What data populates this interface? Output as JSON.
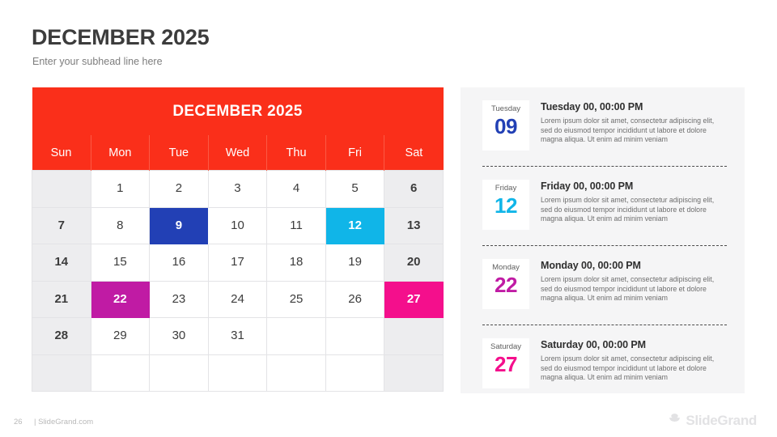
{
  "slide": {
    "title": "DECEMBER 2025",
    "subtitle": "Enter your subhead line here"
  },
  "calendar": {
    "month_title": "DECEMBER 2025",
    "header_color": "#fa2f1a",
    "weekend_bg": "#ededef",
    "day_headers": [
      "Sun",
      "Mon",
      "Tue",
      "Wed",
      "Thu",
      "Fri",
      "Sat"
    ],
    "weeks": [
      [
        {
          "label": "",
          "weekend": true,
          "highlight": null
        },
        {
          "label": "1",
          "weekend": false,
          "highlight": null
        },
        {
          "label": "2",
          "weekend": false,
          "highlight": null
        },
        {
          "label": "3",
          "weekend": false,
          "highlight": null
        },
        {
          "label": "4",
          "weekend": false,
          "highlight": null
        },
        {
          "label": "5",
          "weekend": false,
          "highlight": null
        },
        {
          "label": "6",
          "weekend": true,
          "highlight": null
        }
      ],
      [
        {
          "label": "7",
          "weekend": true,
          "highlight": null
        },
        {
          "label": "8",
          "weekend": false,
          "highlight": null
        },
        {
          "label": "9",
          "weekend": false,
          "highlight": "#2240b5"
        },
        {
          "label": "10",
          "weekend": false,
          "highlight": null
        },
        {
          "label": "11",
          "weekend": false,
          "highlight": null
        },
        {
          "label": "12",
          "weekend": false,
          "highlight": "#10b5e8"
        },
        {
          "label": "13",
          "weekend": true,
          "highlight": null
        }
      ],
      [
        {
          "label": "14",
          "weekend": true,
          "highlight": null
        },
        {
          "label": "15",
          "weekend": false,
          "highlight": null
        },
        {
          "label": "16",
          "weekend": false,
          "highlight": null
        },
        {
          "label": "17",
          "weekend": false,
          "highlight": null
        },
        {
          "label": "18",
          "weekend": false,
          "highlight": null
        },
        {
          "label": "19",
          "weekend": false,
          "highlight": null
        },
        {
          "label": "20",
          "weekend": true,
          "highlight": null
        }
      ],
      [
        {
          "label": "21",
          "weekend": true,
          "highlight": null
        },
        {
          "label": "22",
          "weekend": false,
          "highlight": "#c01ba4"
        },
        {
          "label": "23",
          "weekend": false,
          "highlight": null
        },
        {
          "label": "24",
          "weekend": false,
          "highlight": null
        },
        {
          "label": "25",
          "weekend": false,
          "highlight": null
        },
        {
          "label": "26",
          "weekend": false,
          "highlight": null
        },
        {
          "label": "27",
          "weekend": true,
          "highlight": "#f40f8c"
        }
      ],
      [
        {
          "label": "28",
          "weekend": true,
          "highlight": null
        },
        {
          "label": "29",
          "weekend": false,
          "highlight": null
        },
        {
          "label": "30",
          "weekend": false,
          "highlight": null
        },
        {
          "label": "31",
          "weekend": false,
          "highlight": null
        },
        {
          "label": "",
          "weekend": false,
          "highlight": null
        },
        {
          "label": "",
          "weekend": false,
          "highlight": null
        },
        {
          "label": "",
          "weekend": true,
          "highlight": null
        }
      ],
      [
        {
          "label": "",
          "weekend": true,
          "highlight": null
        },
        {
          "label": "",
          "weekend": false,
          "highlight": null
        },
        {
          "label": "",
          "weekend": false,
          "highlight": null
        },
        {
          "label": "",
          "weekend": false,
          "highlight": null
        },
        {
          "label": "",
          "weekend": false,
          "highlight": null
        },
        {
          "label": "",
          "weekend": false,
          "highlight": null
        },
        {
          "label": "",
          "weekend": true,
          "highlight": null
        }
      ]
    ]
  },
  "events": [
    {
      "dow": "Tuesday",
      "day": "09",
      "day_color": "#2240b5",
      "title": "Tuesday 00, 00:00 PM",
      "desc": "Lorem ipsum dolor sit amet, consectetur adipiscing elit, sed do eiusmod tempor incididunt ut labore et dolore magna aliqua. Ut enim ad minim veniam"
    },
    {
      "dow": "Friday",
      "day": "12",
      "day_color": "#10b5e8",
      "title": "Friday 00, 00:00 PM",
      "desc": "Lorem ipsum dolor sit amet, consectetur adipiscing elit, sed do eiusmod tempor incididunt ut labore et dolore magna aliqua. Ut enim ad minim veniam"
    },
    {
      "dow": "Monday",
      "day": "22",
      "day_color": "#c01ba4",
      "title": "Monday 00, 00:00 PM",
      "desc": "Lorem ipsum dolor sit amet, consectetur adipiscing elit, sed do eiusmod tempor incididunt ut labore et dolore magna aliqua. Ut enim ad minim veniam"
    },
    {
      "dow": "Saturday",
      "day": "27",
      "day_color": "#f40f8c",
      "title": "Saturday 00, 00:00 PM",
      "desc": "Lorem ipsum dolor sit amet, consectetur adipiscing elit, sed do eiusmod tempor incididunt ut labore et dolore magna aliqua. Ut enim ad minim veniam"
    }
  ],
  "footer": {
    "page_number": "26",
    "site": "| SlideGrand.com",
    "brand": "SlideGrand",
    "brand_icon": "stack-bowl-icon"
  }
}
